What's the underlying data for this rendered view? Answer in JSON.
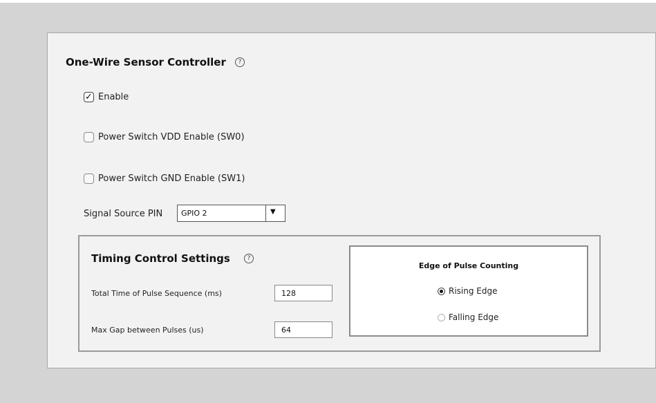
{
  "controller": {
    "title": "One-Wire Sensor Controller",
    "help_icon": "question-circle-icon"
  },
  "options": [
    {
      "label": "Enable",
      "checked": true
    },
    {
      "label": "Power Switch VDD Enable (SW0)",
      "checked": false
    },
    {
      "label": "Power Switch GND Enable (SW1)",
      "checked": false
    }
  ],
  "signal_source": {
    "label": "Signal Source PIN",
    "value": "GPIO 2",
    "arrow_icon": "triangle-down-icon"
  },
  "timing": {
    "title": "Timing Control Settings",
    "help_icon": "question-circle-icon",
    "total_time_label": "Total Time of Pulse Sequence (ms)",
    "total_time_value": "128",
    "max_gap_label": "Max Gap between Pulses (us)",
    "max_gap_value": "64"
  },
  "edge": {
    "title": "Edge of Pulse Counting",
    "options": [
      {
        "label": "Rising Edge",
        "selected": true
      },
      {
        "label": "Falling Edge",
        "selected": false
      }
    ]
  }
}
